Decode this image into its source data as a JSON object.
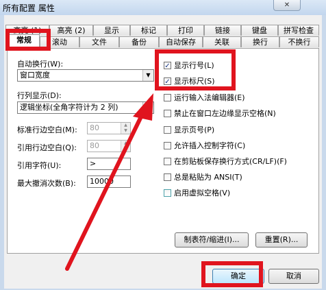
{
  "window": {
    "title": "所有配置 属性",
    "close_icon": "✕"
  },
  "tabs_row1": [
    {
      "label": "高亮 (1)"
    },
    {
      "label": "高亮 (2)"
    },
    {
      "label": "显示"
    },
    {
      "label": "标记"
    },
    {
      "label": "打印"
    },
    {
      "label": "链接"
    },
    {
      "label": "键盘"
    },
    {
      "label": "拼写检查"
    }
  ],
  "tabs_row2": [
    {
      "label": "常规"
    },
    {
      "label": "滚动"
    },
    {
      "label": "文件"
    },
    {
      "label": "备份"
    },
    {
      "label": "自动保存"
    },
    {
      "label": "关联"
    },
    {
      "label": "换行"
    },
    {
      "label": "不换行"
    }
  ],
  "left": {
    "wrap_label": "自动换行(W):",
    "wrap_value": "窗口宽度",
    "linenum_label": "行列显示(D):",
    "linenum_value": "逻辑坐标(全角字符计为 2 列)",
    "margin_label": "标准行边空白(M):",
    "margin_value": "80",
    "quote_margin_label": "引用行边空白(Q):",
    "quote_margin_value": "80",
    "quote_char_label": "引用字符(U):",
    "quote_char_value": ">",
    "undo_label": "最大撤消次数(B):",
    "undo_value": "10000"
  },
  "options": [
    {
      "label": "显示行号(L)",
      "checked": true,
      "mark": "✓"
    },
    {
      "label": "显示标尺(S)",
      "checked": true,
      "mark": "✓"
    },
    {
      "label": "运行输入法编辑器(E)",
      "checked": false,
      "mark": ""
    },
    {
      "label": "禁止在窗口左边缘显示空格(N)",
      "checked": false,
      "mark": ""
    },
    {
      "label": "显示页号(P)",
      "checked": false,
      "mark": ""
    },
    {
      "label": "允许插入控制字符(C)",
      "checked": false,
      "mark": ""
    },
    {
      "label": "在剪贴板保存换行方式(CR/LF)(F)",
      "checked": false,
      "mark": ""
    },
    {
      "label": "总是粘贴为 ANSI(T)",
      "checked": false,
      "mark": ""
    },
    {
      "label": "启用虚拟空格(V)",
      "checked": false,
      "mark": ""
    }
  ],
  "buttons": {
    "tab_indent": "制表符/缩进(I)...",
    "reset": "重置(R)...",
    "ok": "确定",
    "cancel": "取消"
  },
  "colors": {
    "highlight": "#e0141e"
  }
}
